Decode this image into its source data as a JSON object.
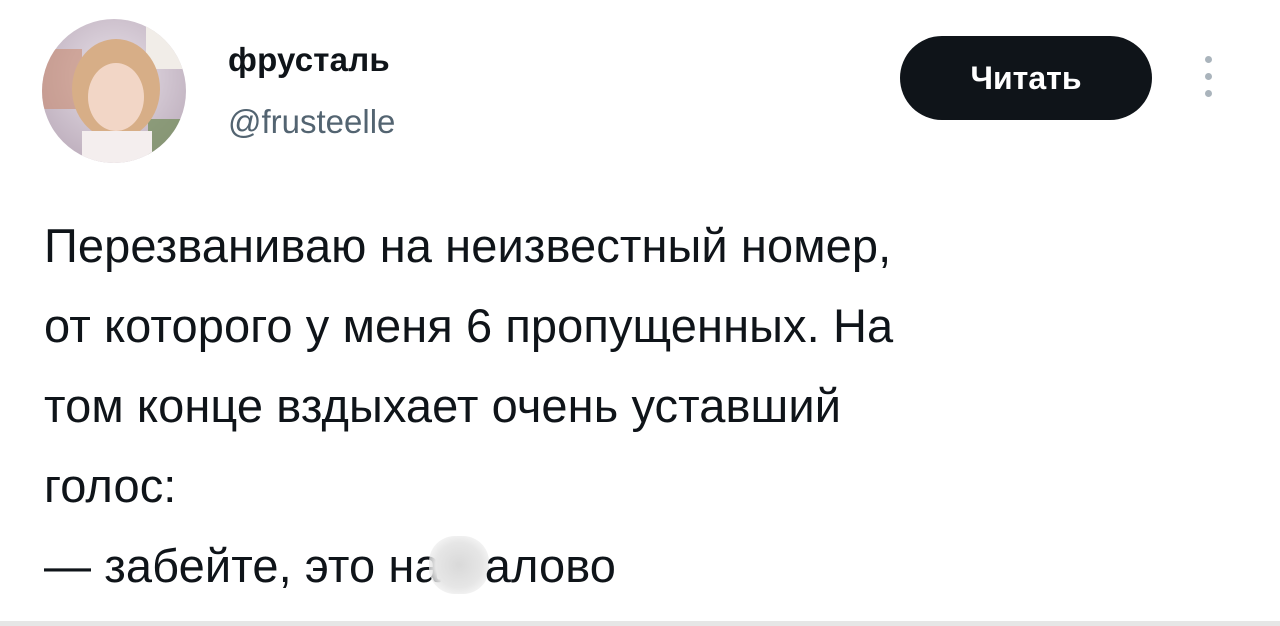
{
  "author": {
    "display_name": "фрусталь",
    "handle": "@frusteelle"
  },
  "actions": {
    "follow_label": "Читать",
    "more_icon": "more-vertical-icon"
  },
  "tweet": {
    "lines": [
      "Перезваниваю на неизвестный номер,",
      "от которого у меня 6 пропущенных. На",
      "том конце вздыхает очень уставший",
      "голос:"
    ],
    "last_line_before": "— забейте, это на",
    "last_line_after": "алово"
  },
  "colors": {
    "text": "#0f1419",
    "secondary": "#536471",
    "button_bg": "#0f1419",
    "button_text": "#ffffff"
  }
}
